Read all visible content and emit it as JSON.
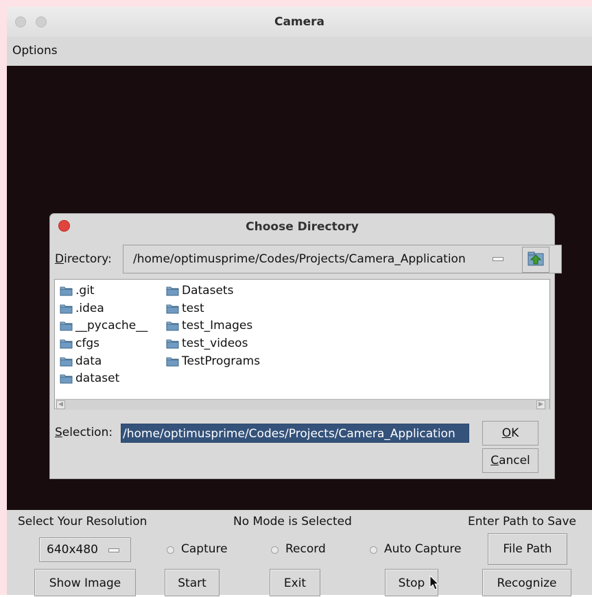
{
  "window": {
    "title": "Camera",
    "menu": [
      "Options"
    ]
  },
  "dialog": {
    "title": "Choose Directory",
    "directory_label_accel": "D",
    "directory_label_rest": "irectory:",
    "directory_value": "/home/optimusprime/Codes/Projects/Camera_Application",
    "files_col1": [
      ".git",
      ".idea",
      "__pycache__",
      "cfgs",
      "data",
      "dataset"
    ],
    "files_col2": [
      "Datasets",
      "test",
      "test_Images",
      "test_videos",
      "TestPrograms"
    ],
    "selection_label_accel": "S",
    "selection_label_rest": "election:",
    "selection_value": "/home/optimusprime/Codes/Projects/Camera_Application",
    "ok_accel": "O",
    "ok_rest": "K",
    "cancel_accel": "C",
    "cancel_rest": "ancel"
  },
  "controls": {
    "resolution_label": "Select Your Resolution",
    "mode_status": "No Mode is Selected",
    "path_label": "Enter Path to Save",
    "resolution_value": "640x480",
    "radio_capture": "Capture",
    "radio_record": "Record",
    "radio_auto": "Auto Capture",
    "file_path_button": "File Path",
    "show_image_button": "Show Image",
    "start_button": "Start",
    "exit_button": "Exit",
    "stop_button": "Stop",
    "recognize_button": "Recognize"
  },
  "colors": {
    "video_bg": "#190c0e",
    "selection_highlight": "#34527a",
    "close_dot": "#e0443e"
  }
}
